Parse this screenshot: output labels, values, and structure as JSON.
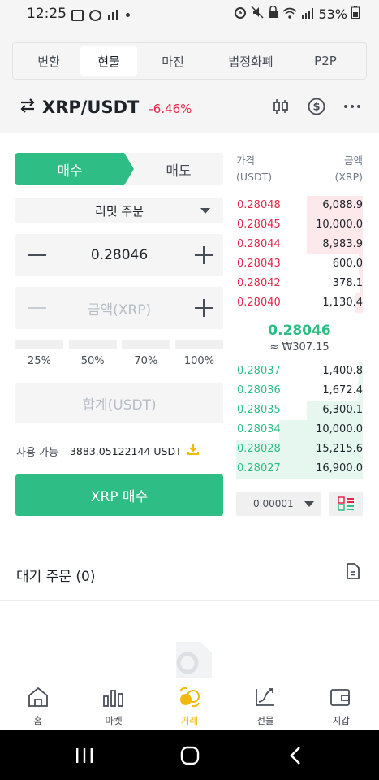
{
  "status": {
    "time": "12:25",
    "battery": "53%"
  },
  "tabs": [
    {
      "label": "변환"
    },
    {
      "label": "현물",
      "active": true
    },
    {
      "label": "마진"
    },
    {
      "label": "법정화폐"
    },
    {
      "label": "P2P"
    }
  ],
  "pair": {
    "name": "XRP/USDT",
    "change": "-6.46%"
  },
  "order_form": {
    "buy_label": "매수",
    "sell_label": "매도",
    "order_type": "리밋 주문",
    "price": "0.28046",
    "amount_placeholder": "금액(XRP)",
    "percentages": [
      "25%",
      "50%",
      "70%",
      "100%"
    ],
    "total_placeholder": "합계(USDT)",
    "available_label": "사용 가능",
    "available_value": "3883.05122144 USDT",
    "submit_label": "XRP 매수"
  },
  "orderbook": {
    "price_header": "가격",
    "price_unit": "(USDT)",
    "amount_header": "금액",
    "amount_unit": "(XRP)",
    "asks": [
      {
        "price": "0.28048",
        "amount": "6,088.9",
        "depth": 0.44
      },
      {
        "price": "0.28045",
        "amount": "10,000.0",
        "depth": 0.44
      },
      {
        "price": "0.28044",
        "amount": "8,983.9",
        "depth": 0.44
      },
      {
        "price": "0.28043",
        "amount": "600.0",
        "depth": 0.03
      },
      {
        "price": "0.28042",
        "amount": "378.1",
        "depth": 0.02
      },
      {
        "price": "0.28040",
        "amount": "1,130.4",
        "depth": 0.06
      }
    ],
    "mid_price": "0.28046",
    "mid_krw": "≈ ₩307.15",
    "bids": [
      {
        "price": "0.28037",
        "amount": "1,400.8",
        "depth": 0.03
      },
      {
        "price": "0.28036",
        "amount": "1,672.4",
        "depth": 0.04
      },
      {
        "price": "0.28035",
        "amount": "6,300.1",
        "depth": 0.44
      },
      {
        "price": "0.28034",
        "amount": "10,000.0",
        "depth": 0.66
      },
      {
        "price": "0.28028",
        "amount": "15,215.6",
        "depth": 1.0
      },
      {
        "price": "0.28027",
        "amount": "16,900.0",
        "depth": 1.0
      }
    ],
    "tick_size": "0.00001"
  },
  "pending": {
    "title": "대기 주문 (0)"
  },
  "nav": [
    {
      "label": "홈",
      "icon": "home-icon"
    },
    {
      "label": "마켓",
      "icon": "market-icon"
    },
    {
      "label": "거래",
      "icon": "trade-icon",
      "active": true
    },
    {
      "label": "선물",
      "icon": "futures-icon"
    },
    {
      "label": "지갑",
      "icon": "wallet-icon"
    }
  ],
  "colors": {
    "buy": "#2ebd85",
    "sell": "#e0294a",
    "accent": "#f0b90b"
  }
}
